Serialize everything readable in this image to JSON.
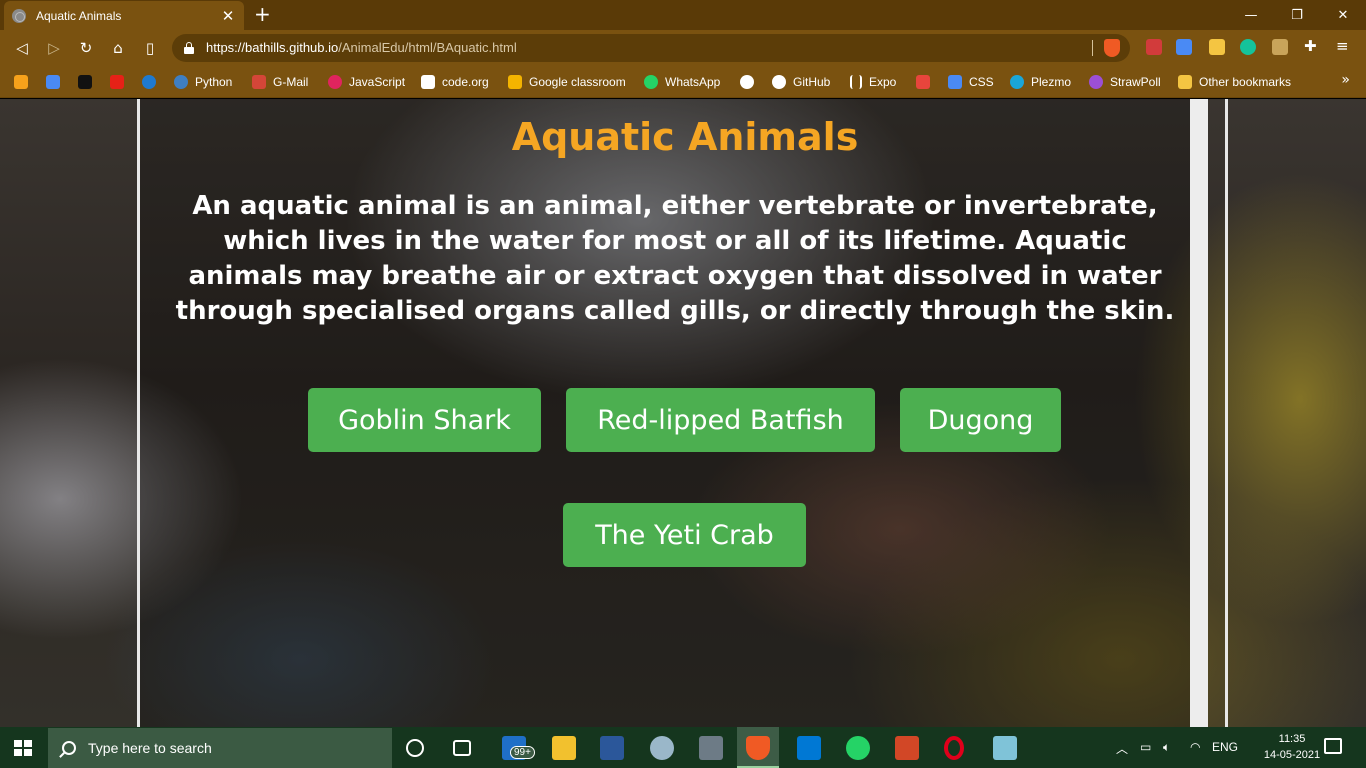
{
  "browser": {
    "tab_title": "Aquatic Animals",
    "url_host": "https://bathills.github.io",
    "url_path": "/AnimalEdu/html/BAquatic.html"
  },
  "bookmarks": [
    {
      "label": "",
      "icon": "flame-icon",
      "color": "#f7a21b"
    },
    {
      "label": "",
      "icon": "google-translate-icon",
      "color": "#4a8af4"
    },
    {
      "label": "",
      "icon": "b-icon",
      "color": "#111111"
    },
    {
      "label": "",
      "icon": "youtube-icon",
      "color": "#e62117"
    },
    {
      "label": "",
      "icon": "play-icon",
      "color": "#1f7ad0"
    },
    {
      "label": "Python",
      "icon": "python-icon",
      "color": "#3f7fc2"
    },
    {
      "label": "G-Mail",
      "icon": "gmail-icon",
      "color": "#d44638"
    },
    {
      "label": "JavaScript",
      "icon": "star-icon",
      "color": "#e0245e"
    },
    {
      "label": "code.org",
      "icon": "grid-icon",
      "color": "#ffffff"
    },
    {
      "label": "Google classroom",
      "icon": "classroom-icon",
      "color": "#f4b400"
    },
    {
      "label": "WhatsApp",
      "icon": "whatsapp-icon",
      "color": "#25d366"
    },
    {
      "label": "",
      "icon": "wheel-icon",
      "color": "#ffffff"
    },
    {
      "label": "GitHub",
      "icon": "github-icon",
      "color": "#ffffff"
    },
    {
      "label": "Expo",
      "icon": "expo-icon",
      "color": "#ffffff"
    },
    {
      "label": "",
      "icon": "store-icon",
      "color": "#e8453c"
    },
    {
      "label": "CSS",
      "icon": "css-icon",
      "color": "#4a8af4"
    },
    {
      "label": "Plezmo",
      "icon": "plezmo-icon",
      "color": "#1aa6d8"
    },
    {
      "label": "StrawPoll",
      "icon": "strawpoll-icon",
      "color": "#9c4fd6"
    },
    {
      "label": "Other bookmarks",
      "icon": "folder-icon",
      "color": "#f4c542"
    }
  ],
  "page": {
    "title": "Aquatic Animals",
    "intro": "An aquatic animal is an animal, either vertebrate or invertebrate, which lives in the water for most or all of its lifetime. Aquatic animals may breathe air or extract oxygen that dissolved in water through specialised organs called gills, or directly through the skin.",
    "buttons": [
      "Goblin Shark",
      "Red-lipped Batfish",
      "Dugong",
      "The Yeti Crab"
    ],
    "title_color": "#f5a623",
    "button_color": "#4caf50"
  },
  "taskbar": {
    "search_placeholder": "Type here to search",
    "mail_badge": "99+",
    "language": "ENG",
    "time": "11:35",
    "date": "14-05-2021"
  }
}
